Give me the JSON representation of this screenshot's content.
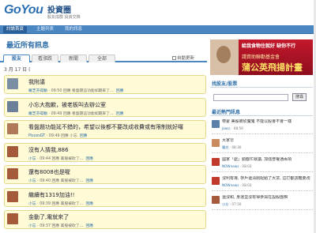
{
  "header": {
    "logo": "GoYou",
    "brand": "投資圈",
    "tagline": "股友成群 投資交鋒",
    "nav": [
      "討論首頁",
      "主題列表",
      "我的訊息"
    ]
  },
  "main": {
    "title": "最近所有訊息",
    "tabs": [
      "股友",
      "看漲跌",
      "新聞",
      "全部"
    ],
    "refresh_label": "自動更新",
    "date": "3 月 17 日 (",
    "messages": [
      {
        "text": "我附議",
        "user": "羅芝芬得動",
        "time": "09:50",
        "extra": "回應 看盤題這功能如期來了…",
        "reply": "回應",
        "avatar_color": "#7a8fa3"
      },
      {
        "text": "小忘大抱歉，被老板叫去辦公室",
        "user": "羅芝芬得動",
        "time": "09:49",
        "extra": "回應 看盤題這功能如期來了…",
        "reply": "回應",
        "avatar_color": "#6d8099"
      },
      {
        "text": "看盤題功能延不錯的，希望以後都不要改成收費或有限制就好囉",
        "user": "PiscesGT",
        "time": "09:49",
        "extra": "回應 小忘",
        "reply": "回應",
        "avatar_color": "#b07a5a"
      },
      {
        "text": "沒有人猜我,886",
        "user": "小忘",
        "time": "09:44",
        "extra": "回應 美股被砍了…",
        "reply": "回應",
        "avatar_color": "#a65a3c"
      },
      {
        "text": "還有8008也是喔",
        "user": "小忘",
        "time": "09:40",
        "extra": "回應 美股被砍了…",
        "reply": "回應",
        "avatar_color": "#a65a3c"
      },
      {
        "text": "繼續有1319加油!!",
        "user": "小忘",
        "time": "09:39",
        "extra": "回應 美股被砍了…",
        "reply": "回應",
        "avatar_color": "#a65a3c"
      },
      {
        "text": "金動了,電就來了",
        "user": "小忘",
        "time": "09:37",
        "extra": "回應 美股被砍了…",
        "reply": "回應",
        "avatar_color": "#a65a3c"
      }
    ]
  },
  "sidebar": {
    "ad": {
      "line1": "給我食物住就好 缺你不行",
      "line2": "請資助聯勸基金會",
      "line3": "蒲公英飛揚計畫"
    },
    "find_title": "找股友/股票",
    "find_button": "搜尋",
    "latest_title": "最近熱門訊息",
    "items": [
      {
        "text": "帶蒙 美股被砍魔鬼 不能以股會不會一樣",
        "user": "jaasc",
        "time": "08:59",
        "thumb": "#5a7fa8"
      },
      {
        "text": "大家早",
        "user": "羅芝",
        "time": "08:30",
        "thumb": "#c98a5c"
      },
      {
        "text": "國家「處」勤都忙就議, 加強普權通兩項",
        "user": "NOWnews",
        "time": "08:03",
        "thumb": "#c0392b"
      },
      {
        "text": "沒利有導, 存戶還清削配給了大眾, 這打都該離要改變借貸",
        "user": "NOWnews",
        "time": "08:03",
        "thumb": "#c0392b"
      },
      {
        "text": "還沒和, 身運並沒有得參與在設股團棋",
        "user": "小忘",
        "time": "07:50",
        "thumb": "#a65a3c"
      }
    ]
  }
}
